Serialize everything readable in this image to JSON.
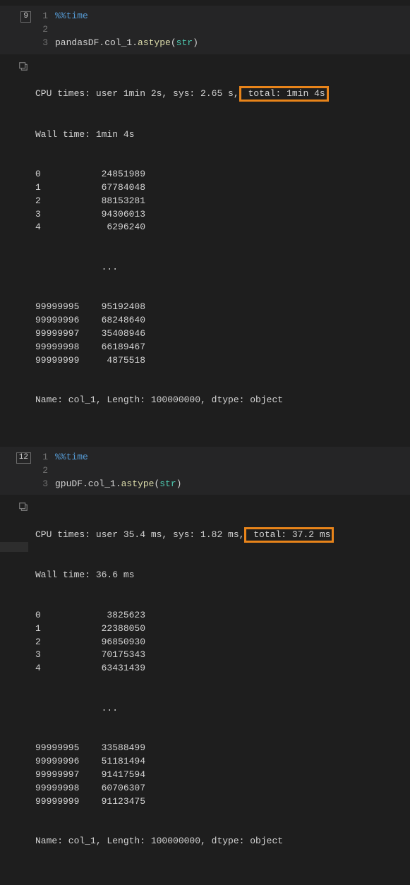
{
  "colors": {
    "accent": "#e8841a",
    "magic": "#569cd6",
    "builtin": "#4ec9b0"
  },
  "cells": [
    {
      "exec_count": "9",
      "code": {
        "line1_magic": "%%time",
        "line2": "",
        "line3_obj": "pandasDF.col_1.",
        "line3_func": "astype",
        "line3_paren_open": "(",
        "line3_arg": "str",
        "line3_paren_close": ")"
      },
      "output": {
        "timing_pre": "CPU times: user 1min 2s, sys: 2.65 s,",
        "timing_hl": " total: 1min 4s",
        "wall": "Wall time: 1min 4s",
        "rows": [
          [
            "0",
            "24851989"
          ],
          [
            "1",
            "67784048"
          ],
          [
            "2",
            "88153281"
          ],
          [
            "3",
            "94306013"
          ],
          [
            "4",
            "6296240"
          ]
        ],
        "ellipsis": "            ...   ",
        "rows2": [
          [
            "99999995",
            "95192408"
          ],
          [
            "99999996",
            "68248640"
          ],
          [
            "99999997",
            "35408946"
          ],
          [
            "99999998",
            "66189467"
          ],
          [
            "99999999",
            "4875518"
          ]
        ],
        "meta": "Name: col_1, Length: 100000000, dtype: object"
      }
    },
    {
      "exec_count": "12",
      "code": {
        "line1_magic": "%%time",
        "line2": "",
        "line3_obj": "gpuDF.col_1.",
        "line3_func": "astype",
        "line3_paren_open": "(",
        "line3_arg": "str",
        "line3_paren_close": ")"
      },
      "output": {
        "timing_pre": "CPU times: user 35.4 ms, sys: 1.82 ms,",
        "timing_hl": " total: 37.2 ms",
        "wall": "Wall time: 36.6 ms",
        "rows": [
          [
            "0",
            "3825623"
          ],
          [
            "1",
            "22388050"
          ],
          [
            "2",
            "96850930"
          ],
          [
            "3",
            "70175343"
          ],
          [
            "4",
            "63431439"
          ]
        ],
        "ellipsis": "            ...   ",
        "rows2": [
          [
            "99999995",
            "33588499"
          ],
          [
            "99999996",
            "51181494"
          ],
          [
            "99999997",
            "91417594"
          ],
          [
            "99999998",
            "60706307"
          ],
          [
            "99999999",
            "91123475"
          ]
        ],
        "meta": "Name: col_1, Length: 100000000, dtype: object"
      }
    }
  ],
  "line_numbers": {
    "l1": "1",
    "l2": "2",
    "l3": "3"
  },
  "chart_data": {
    "type": "table",
    "title": "Execution time comparison: pandas vs gpuDF astype(str)",
    "rows": [
      {
        "label": "pandasDF.col_1.astype(str)",
        "cpu_user": "1min 2s",
        "cpu_sys": "2.65 s",
        "cpu_total": "1min 4s",
        "wall": "1min 4s"
      },
      {
        "label": "gpuDF.col_1.astype(str)",
        "cpu_user": "35.4 ms",
        "cpu_sys": "1.82 ms",
        "cpu_total": "37.2 ms",
        "wall": "36.6 ms"
      }
    ]
  }
}
